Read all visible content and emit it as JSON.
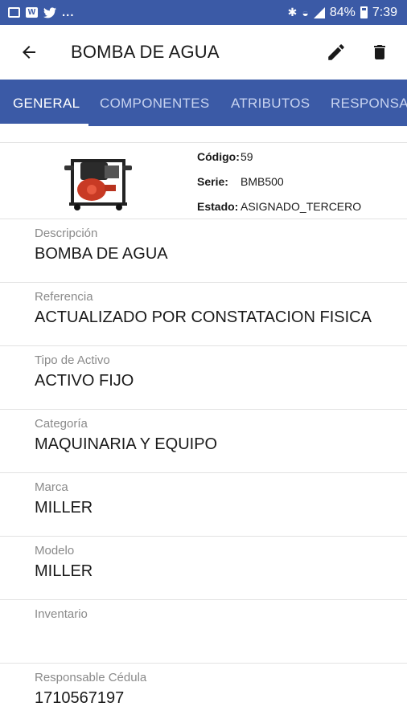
{
  "status_bar": {
    "battery": "84%",
    "time": "7:39",
    "overflow": "..."
  },
  "app_bar": {
    "title": "BOMBA DE AGUA"
  },
  "tabs": [
    {
      "label": "GENERAL",
      "active": true
    },
    {
      "label": "COMPONENTES",
      "active": false
    },
    {
      "label": "ATRIBUTOS",
      "active": false
    },
    {
      "label": "RESPONSA",
      "active": false
    }
  ],
  "summary": {
    "codigo_label": "Código:",
    "codigo_value": "59",
    "serie_label": "Serie:",
    "serie_value": "BMB500",
    "estado_label": "Estado:",
    "estado_value": "ASIGNADO_TERCERO"
  },
  "fields": [
    {
      "label": "Descripción",
      "value": "BOMBA DE AGUA"
    },
    {
      "label": "Referencia",
      "value": "ACTUALIZADO POR CONSTATACION FISICA"
    },
    {
      "label": "Tipo de Activo",
      "value": "ACTIVO FIJO"
    },
    {
      "label": "Categoría",
      "value": "MAQUINARIA Y EQUIPO"
    },
    {
      "label": "Marca",
      "value": "MILLER"
    },
    {
      "label": "Modelo",
      "value": "MILLER"
    },
    {
      "label": "Inventario",
      "value": ""
    },
    {
      "label": "Responsable Cédula",
      "value": "1710567197"
    }
  ],
  "colors": {
    "primary": "#3b5aa6",
    "tab_inactive": "#c7d3f0",
    "label_gray": "#8a8a8a"
  }
}
